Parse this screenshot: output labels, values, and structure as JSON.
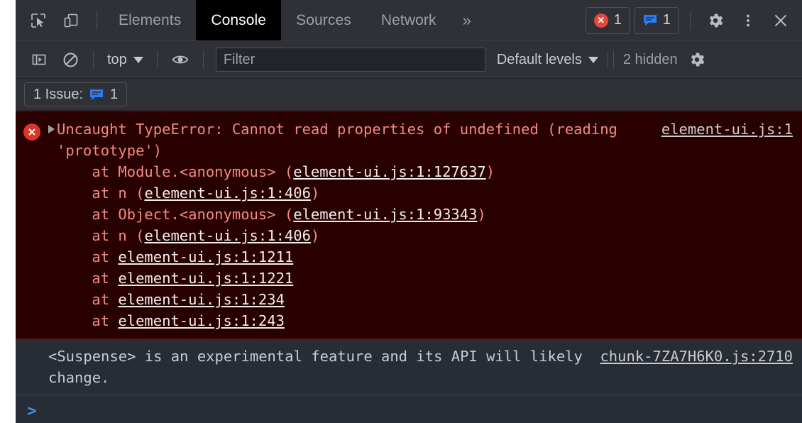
{
  "tabbar": {
    "icons": [
      {
        "name": "inspect-element-icon"
      },
      {
        "name": "device-toolbar-icon"
      }
    ],
    "tabs": [
      {
        "label": "Elements",
        "active": false
      },
      {
        "label": "Console",
        "active": true
      },
      {
        "label": "Sources",
        "active": false
      },
      {
        "label": "Network",
        "active": false
      }
    ],
    "more_label": "»",
    "error_count": "1",
    "message_count": "1",
    "settings_icon": "gear-icon",
    "more_options_icon": "kebab-menu-icon",
    "close_icon": "close-icon"
  },
  "filterbar": {
    "sidebar_toggle_icon": "console-sidebar-icon",
    "clear_icon": "clear-console-icon",
    "context": "top",
    "eye_icon": "live-expression-icon",
    "filter_placeholder": "Filter",
    "filter_value": "",
    "levels": "Default levels",
    "hidden": "2 hidden",
    "settings_icon": "gear-icon"
  },
  "issuebar": {
    "label": "1 Issue:",
    "count": "1"
  },
  "console": {
    "messages": [
      {
        "type": "error",
        "icon": "error-circle-icon",
        "expanded": false,
        "text": "Uncaught TypeError: Cannot read properties of undefined (reading 'prototype')",
        "stack": [
          {
            "prefix": "    at Module.<anonymous> (",
            "link": "element-ui.js:1:127637",
            "suffix": ")"
          },
          {
            "prefix": "    at n (",
            "link": "element-ui.js:1:406",
            "suffix": ")"
          },
          {
            "prefix": "    at Object.<anonymous> (",
            "link": "element-ui.js:1:93343",
            "suffix": ")"
          },
          {
            "prefix": "    at n (",
            "link": "element-ui.js:1:406",
            "suffix": ")"
          },
          {
            "prefix": "    at ",
            "link": "element-ui.js:1:1211",
            "suffix": ""
          },
          {
            "prefix": "    at ",
            "link": "element-ui.js:1:1221",
            "suffix": ""
          },
          {
            "prefix": "    at ",
            "link": "element-ui.js:1:234",
            "suffix": ""
          },
          {
            "prefix": "    at ",
            "link": "element-ui.js:1:243",
            "suffix": ""
          }
        ],
        "source": "element-ui.js:1"
      },
      {
        "type": "info",
        "text": "<Suspense> is an experimental feature and its API will likely change.",
        "source": "chunk-7ZA7H6K0.js:2710"
      }
    ],
    "prompt_symbol": ">",
    "prompt_value": ""
  },
  "colors": {
    "accent_blue": "#4a8df8",
    "error_red": "#e8453c",
    "error_bg": "#290000",
    "error_text": "#f28b82",
    "panel_bg": "#282c34",
    "toolbar_bg": "#2f3136"
  }
}
